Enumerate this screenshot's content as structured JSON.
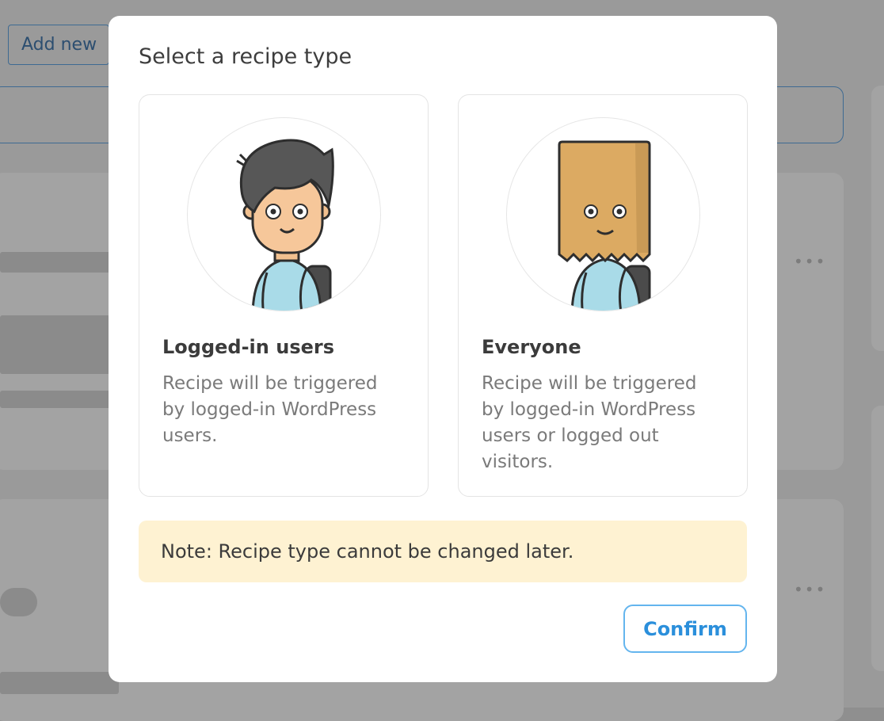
{
  "background": {
    "add_new_label": "Add new"
  },
  "modal": {
    "title": "Select a recipe type",
    "options": [
      {
        "title": "Logged-in users",
        "description": "Recipe will be triggered by logged-in WordPress users.",
        "illustration": "person-with-backpack-illustration"
      },
      {
        "title": "Everyone",
        "description": "Recipe will be triggered by logged-in WordPress users or logged out visitors.",
        "illustration": "paper-bag-head-person-illustration"
      }
    ],
    "note": "Note: Recipe type cannot be changed later.",
    "confirm_label": "Confirm"
  },
  "colors": {
    "note_background": "#fef2d2",
    "confirm_accent": "#2b8fdb",
    "overlay": "#9a9a9a"
  }
}
